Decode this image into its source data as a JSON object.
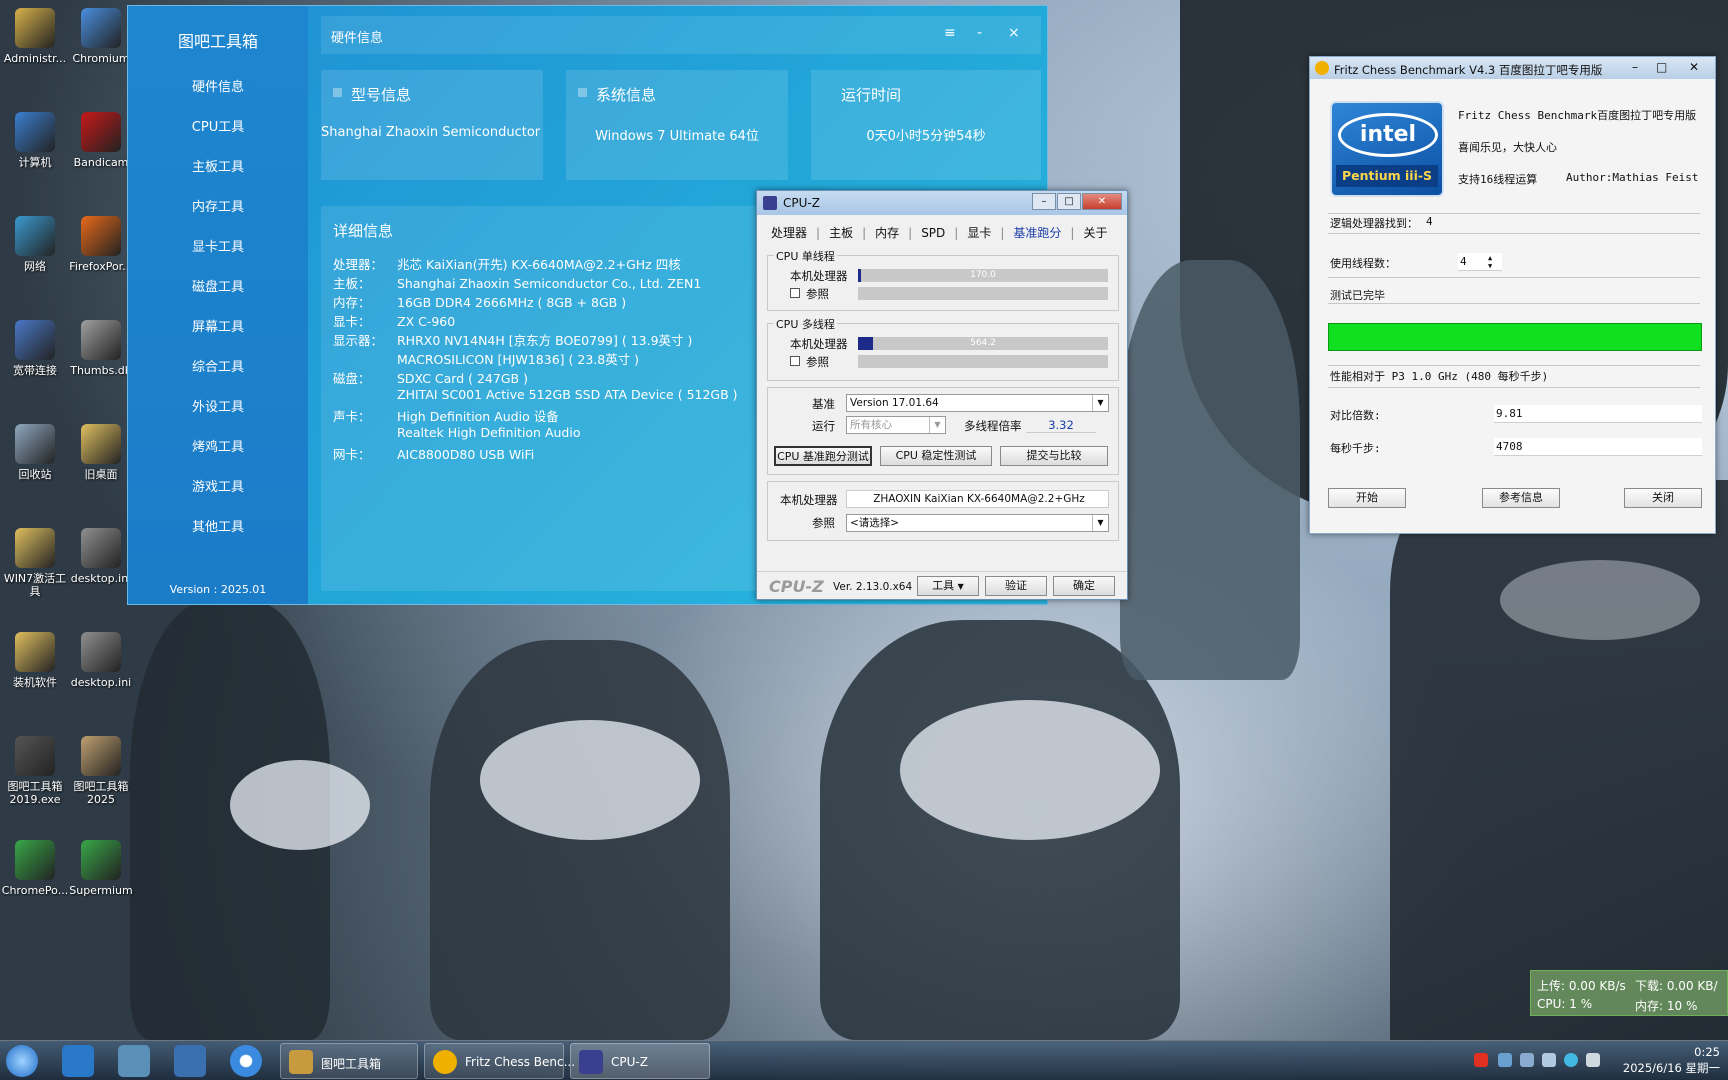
{
  "desktop": {
    "icons": [
      {
        "label": "Administr...",
        "color": "#d8b24a"
      },
      {
        "label": "Chromium",
        "color": "#4a8fe0"
      },
      {
        "label": "计算机",
        "color": "#3b7fd0"
      },
      {
        "label": "Bandicam",
        "color": "#c81818"
      },
      {
        "label": "网络",
        "color": "#3a9ad0"
      },
      {
        "label": "FirefoxPor...",
        "color": "#e86a1a"
      },
      {
        "label": "宽带连接",
        "color": "#4a78c8"
      },
      {
        "label": "Thumbs.db",
        "color": "#a0a0a0"
      },
      {
        "label": "回收站",
        "color": "#8fa8c0"
      },
      {
        "label": "旧桌面",
        "color": "#e0c060"
      },
      {
        "label": "WIN7激活工具",
        "color": "#e0c060"
      },
      {
        "label": "desktop.ini",
        "color": "#909090"
      },
      {
        "label": "装机软件",
        "color": "#e0c060"
      },
      {
        "label": "desktop.ini",
        "color": "#909090"
      },
      {
        "label": "图吧工具箱2019.exe",
        "color": "#555555"
      },
      {
        "label": "图吧工具箱2025",
        "color": "#c0a070"
      },
      {
        "label": "ChromePo...",
        "color": "#38a848"
      },
      {
        "label": "Supermium",
        "color": "#38a848"
      }
    ]
  },
  "toolbox": {
    "brand": "图吧工具箱",
    "nav": [
      "硬件信息",
      "CPU工具",
      "主板工具",
      "内存工具",
      "显卡工具",
      "磁盘工具",
      "屏幕工具",
      "综合工具",
      "外设工具",
      "烤鸡工具",
      "游戏工具",
      "其他工具"
    ],
    "version": "Version : 2025.01",
    "header_title": "硬件信息",
    "controls": {
      "menu": "≡",
      "minimize": "-",
      "close": "×"
    },
    "cards": [
      {
        "title": "型号信息",
        "value": "Shanghai Zhaoxin Semiconductor Co., L"
      },
      {
        "title": "系统信息",
        "value": "Windows 7 Ultimate 64位"
      },
      {
        "title": "运行时间",
        "value": "0天0小时5分钟54秒"
      }
    ],
    "detail_title": "详细信息",
    "details": [
      {
        "key": "处理器：",
        "value": "兆芯 KaiXian(开先) KX-6640MA@2.2+GHz 四核"
      },
      {
        "key": "主板：",
        "value": "Shanghai Zhaoxin Semiconductor Co., Ltd. ZEN1"
      },
      {
        "key": "内存：",
        "value": "16GB DDR4 2666MHz ( 8GB + 8GB )"
      },
      {
        "key": "显卡：",
        "value": "ZX C-960"
      },
      {
        "key": "显示器：",
        "value": "RHRX0 NV14N4H [京东方 BOE0799] ( 13.9英寸 )"
      },
      {
        "key": "",
        "value": "MACROSILICON [HJW1836] ( 23.8英寸 )"
      },
      {
        "key": "磁盘：",
        "value": "SDXC Card ( 247GB )"
      },
      {
        "key": "",
        "value": "ZHITAI SC001 Active 512GB SSD ATA Device ( 512GB )"
      },
      {
        "key": "声卡：",
        "value": "High Definition Audio 设备"
      },
      {
        "key": "",
        "value": "Realtek High Definition Audio"
      },
      {
        "key": "网卡：",
        "value": "AIC8800D80 USB WiFi"
      }
    ]
  },
  "cpuz": {
    "title": "CPU-Z",
    "tabs": [
      "处理器",
      "主板",
      "内存",
      "SPD",
      "显卡",
      "基准跑分",
      "关于"
    ],
    "active_tab": "基准跑分",
    "single": {
      "group": "CPU 单线程",
      "this_label": "本机处理器",
      "value": "170.0",
      "fill": 0.01,
      "ref_label": "参照"
    },
    "multi": {
      "group": "CPU 多线程",
      "this_label": "本机处理器",
      "value": "564.2",
      "fill": 0.06,
      "ref_label": "参照"
    },
    "bench_label": "基准",
    "bench_value": "Version 17.01.64",
    "run_label": "运行",
    "run_value": "所有核心",
    "ratio_label": "多线程倍率",
    "ratio_value": "3.32",
    "buttons": {
      "bench": "CPU 基准跑分测试",
      "stress": "CPU 稳定性测试",
      "submit": "提交与比较"
    },
    "proc_label": "本机处理器",
    "proc_value": "ZHAOXIN KaiXian KX-6640MA@2.2+GHz",
    "ref_label": "参照",
    "ref_value": "<请选择>",
    "footer": {
      "logo": "CPU-Z",
      "version": "Ver. 2.13.0.x64",
      "tools": "工具",
      "validate": "验证",
      "ok": "确定"
    }
  },
  "fritz": {
    "title": "Fritz Chess Benchmark V4.3  百度图拉丁吧专用版",
    "logo_inside": "intel",
    "logo_sub": "Pentium iii-S",
    "header_line1": "Fritz Chess Benchmark百度图拉丁吧专用版",
    "header_line2": "喜闻乐见，大快人心",
    "header_line3a": "支持16线程运算",
    "header_line3b": "Author:Mathias Feist",
    "logical_label": "逻辑处理器找到：",
    "logical_value": "4",
    "threads_label": "使用线程数：",
    "threads_value": "4",
    "status": "测试已完毕",
    "progress": 1.0,
    "perf_label": "性能相对于 P3 1.0 GHz (480 每秒千步)",
    "ratio_label": "对比倍数:",
    "ratio_value": "9.81",
    "kns_label": "每秒千步:",
    "kns_value": "4708",
    "buttons": {
      "start": "开始",
      "info": "参考信息",
      "close": "关闭"
    }
  },
  "netmon": {
    "up": "上传: 0.00 KB/s",
    "down": "下载: 0.00 KB/",
    "cpu": "CPU: 1 %",
    "mem": "内存: 10 %"
  },
  "taskbar": {
    "tasks": [
      "图吧工具箱",
      "Fritz Chess Benc...",
      "CPU-Z"
    ],
    "time": "0:25",
    "date": "2025/6/16 星期一"
  }
}
